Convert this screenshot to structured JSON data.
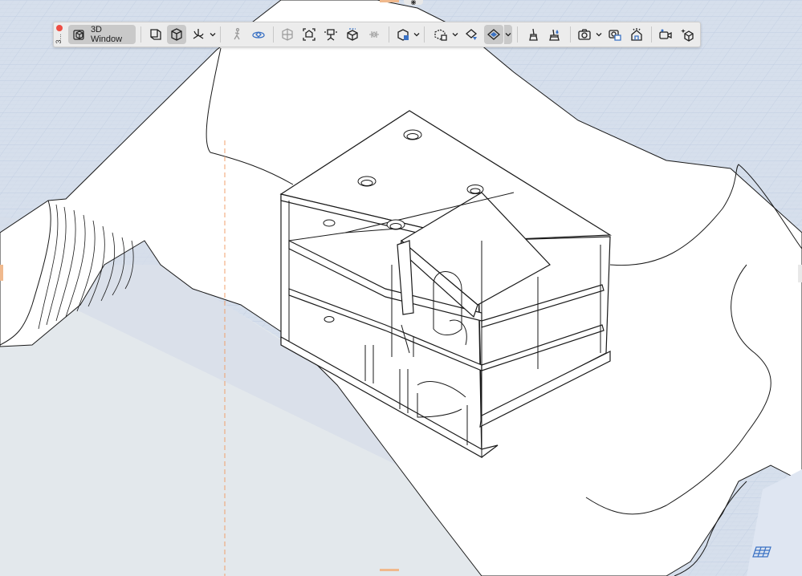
{
  "window": {
    "tab_indicator": "3...",
    "view_label": "3D Window"
  },
  "colors": {
    "background": "#d6dfec",
    "grid_line": "#bdcbe0",
    "ground_plane": "#e3e8ec",
    "model_line": "#1a1a1a",
    "model_fill": "#ffffff",
    "accent_dashed": "#f0a06c",
    "toolbar": "#ececec",
    "close_dot": "#ee4d43"
  },
  "toolbar": {
    "buttons": [
      {
        "name": "3d-window-view-icon",
        "active": true
      },
      {
        "name": "orthographic-icon",
        "active": false
      },
      {
        "name": "perspective-icon",
        "active": true
      },
      {
        "name": "orbit-icon",
        "active": false
      },
      {
        "name": "walk-icon",
        "active": false
      },
      {
        "name": "navigator-icon",
        "active": false
      },
      {
        "name": "model-display-icon",
        "active": false
      },
      {
        "name": "fit-in-window-icon",
        "active": false
      },
      {
        "name": "explode-view-icon",
        "active": false
      },
      {
        "name": "marquee-icon",
        "active": false
      },
      {
        "name": "cutaway-icon",
        "active": false
      },
      {
        "name": "section-box-icon",
        "active": false
      },
      {
        "name": "filter-icon",
        "active": false
      },
      {
        "name": "solid-shading-icon",
        "active": false
      },
      {
        "name": "hidden-line-icon",
        "active": true
      },
      {
        "name": "brush-icon",
        "active": false
      },
      {
        "name": "materials-icon",
        "active": false
      },
      {
        "name": "camera-icon",
        "active": false
      },
      {
        "name": "snapshot-icon",
        "active": false
      },
      {
        "name": "sun-study-icon",
        "active": false
      },
      {
        "name": "video-camera-icon",
        "active": false
      },
      {
        "name": "visual-settings-icon",
        "active": false
      }
    ]
  },
  "viewport": {
    "scene": "hidden-line 3D model of a multi-storey house cut by a section box, on sloped terrain"
  }
}
